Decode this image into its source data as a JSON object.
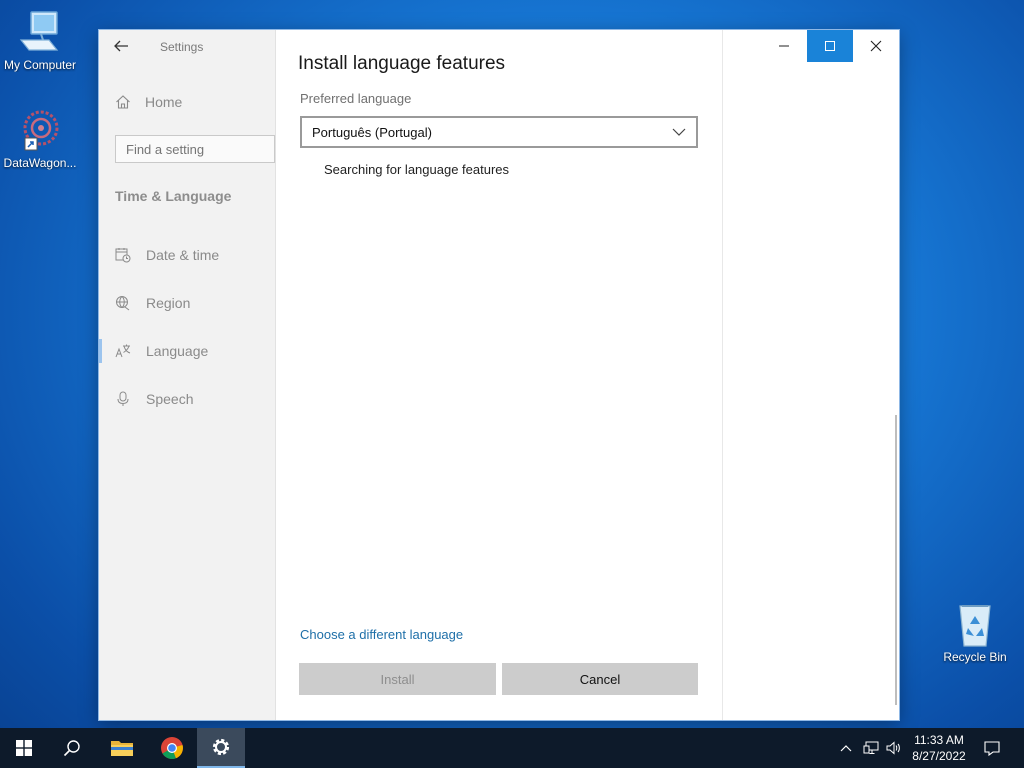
{
  "desktop": {
    "icons": [
      {
        "label": "My Computer"
      },
      {
        "label": "DataWagon..."
      },
      {
        "label": "Recycle Bin"
      }
    ]
  },
  "window": {
    "app_title": "Settings",
    "sidebar": {
      "home_label": "Home",
      "search_placeholder": "Find a setting",
      "section_title": "Time & Language",
      "items": [
        {
          "label": "Date & time",
          "icon": "calendar-clock-icon"
        },
        {
          "label": "Region",
          "icon": "globe-icon"
        },
        {
          "label": "Language",
          "icon": "language-icon",
          "selected": true
        },
        {
          "label": "Speech",
          "icon": "microphone-icon"
        }
      ]
    },
    "content": {
      "title": "Install language features",
      "preferred_label": "Preferred language",
      "selected_language": "Português (Portugal)",
      "status": "Searching for language features",
      "link": "Choose a different language",
      "install_label": "Install",
      "cancel_label": "Cancel"
    }
  },
  "taskbar": {
    "time": "11:33 AM",
    "date": "8/27/2022"
  },
  "colors": {
    "accent": "#1a83d8",
    "link": "#1e6fa8",
    "taskbar": "#0d1a2a"
  }
}
